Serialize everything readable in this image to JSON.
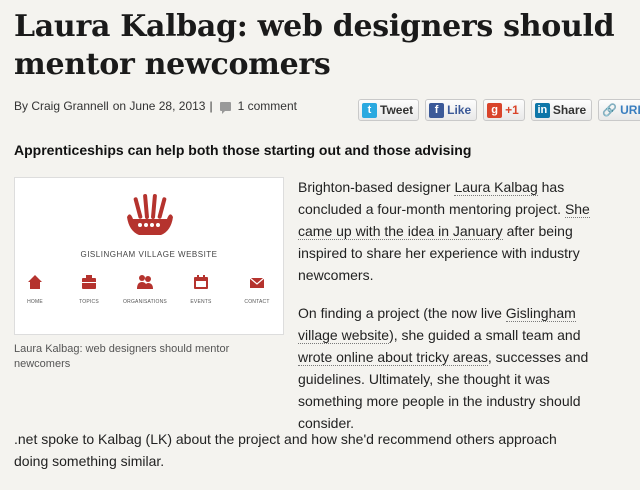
{
  "article": {
    "title": "Laura Kalbag: web designers should mentor newcomers",
    "byline": {
      "author": "By Craig Grannell",
      "date": "on June 28, 2013",
      "separator": "|",
      "comments": "1 comment"
    },
    "subhead": "Apprenticeships can help both those starting out and those advising",
    "figure": {
      "site_name": "GISLINGHAM VILLAGE WEBSITE",
      "nav": [
        {
          "label": "HOME",
          "icon": "house-icon"
        },
        {
          "label": "TOPICS",
          "icon": "topics-icon"
        },
        {
          "label": "ORGANISATIONS",
          "icon": "people-icon"
        },
        {
          "label": "EVENTS",
          "icon": "calendar-icon"
        },
        {
          "label": "CONTACT",
          "icon": "envelope-icon"
        }
      ],
      "caption": "Laura Kalbag: web designers should mentor newcomers"
    },
    "p1": {
      "t1": "Brighton-based designer ",
      "link1": "Laura Kalbag",
      "t2": " has concluded a four-month mentoring project. ",
      "link2": "She came up with the idea in January",
      "t3": " after being inspired to share her experience with industry newcomers."
    },
    "p2": {
      "t1": "On finding a project (the now live ",
      "link1": "Gislingham village website",
      "t2": "), she guided a small team and ",
      "link2": "wrote online about tricky areas",
      "t3": ", successes and guidelines. Ultimately, she thought it was something more people in the industry should consider."
    },
    "p3": ".net spoke to Kalbag (LK) about the project and how she'd recommend others approach doing something similar."
  },
  "share": {
    "tweet": "Tweet",
    "like": "Like",
    "plusone": "+1",
    "linkedin": "Share",
    "url": "URL"
  },
  "colors": {
    "brand_red": "#b5332e",
    "twitter": "#2aa9e0",
    "facebook": "#3b5998",
    "google": "#d9442b",
    "linkedin": "#0e76a8"
  }
}
